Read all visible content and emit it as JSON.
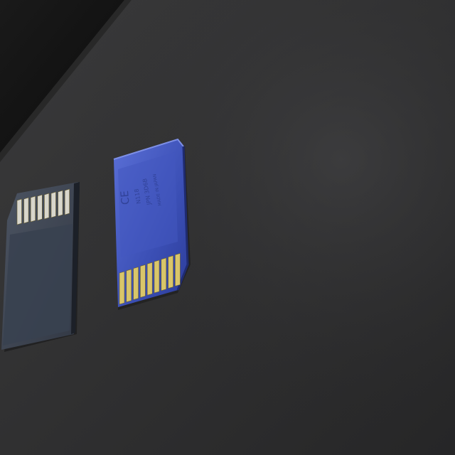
{
  "scene": {
    "description_label": "",
    "colors": {
      "surface": "#2f2f30",
      "surface_highlight": "#3a3a3b",
      "wall_dark": "#111111",
      "card_back_gray": "#3d434d",
      "card_back_gray_light": "#4a5160",
      "card_front_blue": "#3a4fb8",
      "card_front_blue_light": "#5468d0",
      "contact_gold": "#d9c66a",
      "contact_silver": "#d8d6cc"
    }
  },
  "left_card": {
    "side": "back",
    "contacts_count": 8
  },
  "right_card": {
    "side": "front",
    "contacts_count": 9,
    "print_lines": [
      "N118",
      "JPN 3D6B",
      "MADE IN JAPAN"
    ],
    "ce_mark": "CE"
  }
}
